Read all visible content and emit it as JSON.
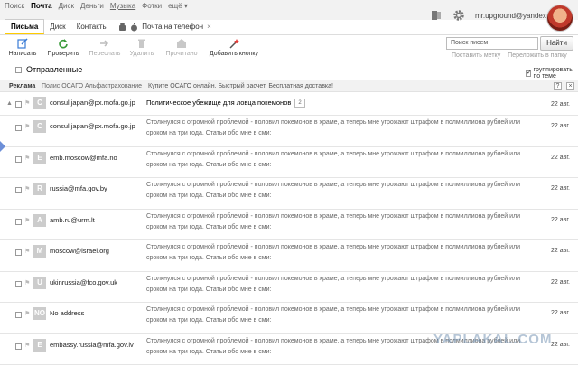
{
  "top_nav": [
    {
      "label": "Поиск",
      "active": false,
      "underline": false
    },
    {
      "label": "Почта",
      "active": true,
      "underline": false
    },
    {
      "label": "Диск",
      "active": false,
      "underline": false
    },
    {
      "label": "Деньги",
      "active": false,
      "underline": false
    },
    {
      "label": "Музыка",
      "active": false,
      "underline": true
    },
    {
      "label": "Фотки",
      "active": false,
      "underline": false
    },
    {
      "label": "ещё ▾",
      "active": false,
      "underline": false
    }
  ],
  "user": {
    "email": "mr.upground@yandex.ru"
  },
  "tabs": [
    {
      "label": "Письма",
      "active": true
    },
    {
      "label": "Диск",
      "active": false
    },
    {
      "label": "Контакты",
      "active": false
    }
  ],
  "phone_tab": {
    "label": "Почта на телефон",
    "close": "×"
  },
  "toolbar": {
    "compose": "Написать",
    "check": "Проверить",
    "forward": "Переслать",
    "delete": "Удалить",
    "read": "Прочитано",
    "add_button": "Добавить кнопку"
  },
  "search": {
    "placeholder": "Поиск писем",
    "button": "Найти"
  },
  "sublinks": {
    "label": "Поставить метку",
    "move": "Переложить в папку"
  },
  "folder": {
    "name": "Отправленные",
    "group_label": "группировать по теме"
  },
  "ad": {
    "label": "Реклама",
    "link": "Полис ОСАГО Альфастрахование",
    "text": "Купите ОСАГО онлайн. Быстрый расчет. Бесплатная доставка!",
    "ctl1": "?",
    "ctl2": "×"
  },
  "first_email": {
    "initial": "C",
    "sender": "consul.japan@px.mofa.go.jp",
    "subject": "Политическое убежище для ловца покемонов",
    "count": "2",
    "date": "22 авг."
  },
  "snippet_text": "Столкнулся с огромной проблемой - половил покемонов в храме, а теперь мне угрожают штрафом в полмиллиона рублей или сроком на три года. Статьи обо мне в сми:",
  "emails": [
    {
      "initial": "C",
      "sender": "consul.japan@px.mofa.go.jp",
      "date": "22 авг."
    },
    {
      "initial": "E",
      "sender": "emb.moscow@mfa.no",
      "date": "22 авг."
    },
    {
      "initial": "R",
      "sender": "russia@mfa.gov.by",
      "date": "22 авг."
    },
    {
      "initial": "A",
      "sender": "amb.ru@urm.lt",
      "date": "22 авг."
    },
    {
      "initial": "M",
      "sender": "moscow@israel.org",
      "date": "22 авг."
    },
    {
      "initial": "U",
      "sender": "ukinrussia@fco.gov.uk",
      "date": "22 авг."
    },
    {
      "initial": "NO",
      "sender": "No address",
      "date": "22 авг."
    },
    {
      "initial": "E",
      "sender": "embassy.russia@mfa.gov.lv",
      "date": "22 авг."
    }
  ],
  "watermark": "YAPLAKAL.COM",
  "colors": {
    "accent": "#ffcc00",
    "avatar_bg": "#cccccc",
    "sidemark": "#6d8fd8"
  }
}
